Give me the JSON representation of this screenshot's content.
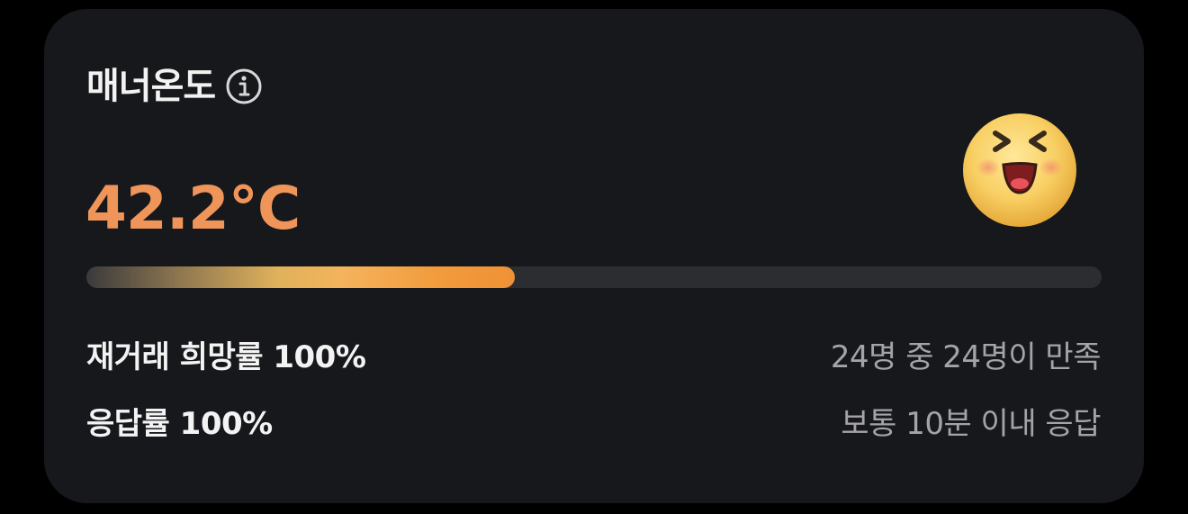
{
  "card": {
    "title": "매너온도",
    "temperature": "42.2°C",
    "progress_percent": 42.2,
    "colors": {
      "temperature": "#f0955a",
      "bar_end": "#ef9235",
      "bar_mid": "#f4b35c",
      "background": "#17181b",
      "track": "#2c2d31"
    },
    "stats": [
      {
        "label": "재거래 희망률 100%",
        "detail": "24명 중 24명이 만족"
      },
      {
        "label": "응답률 100%",
        "detail": "보통 10분 이내 응답"
      }
    ],
    "icons": {
      "info": "info-circle-icon",
      "mood": "laughing-face-emoji"
    }
  }
}
